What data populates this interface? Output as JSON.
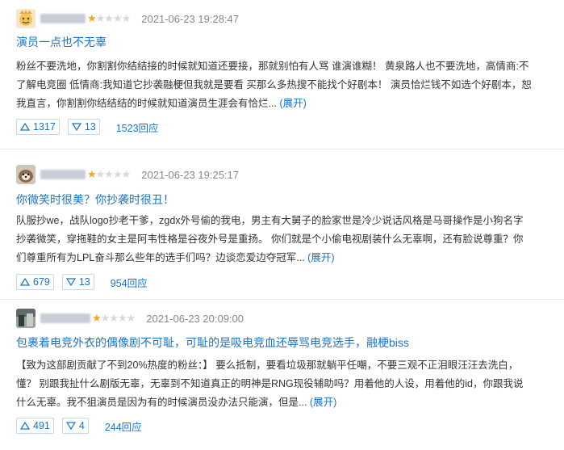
{
  "reviews": [
    {
      "rating": 1,
      "time": "2021-06-23 19:28:47",
      "title": "演员一点也不无辜",
      "content": "粉丝不要洗地，你割割你结结接的时候就知道还要接，那就别怕有人骂 谁演谁糊！ 黄泉路人也不要洗地，高情商:不了解电竞圈 低情商:我知道它抄袭融梗但我就是要看 买那么多热搜不能找个好剧本！ 演员恰烂钱不如选个好剧本，恕我直言，你割割你结结结的时候就知道演员生涯会有恰烂...",
      "expand": "(展开)",
      "up": "1317",
      "down": "13",
      "replies": "1523回应"
    },
    {
      "rating": 1,
      "time": "2021-06-23 19:25:17",
      "title": "你微笑时很美？你抄袭时很丑！",
      "content": "队服抄we，战队logo抄老干爹，zgdx外号偷的我电，男主有大舅子的脸家世是冷少说话风格是马哥操作是小狗名字抄袭微笑，穿拖鞋的女主是阿韦性格是谷夜外号是重扬。 你们就是个小偷电视剧装什么无辜啊，还有脸说尊重？你们尊重所有为LPL奋斗那么些年的选手们吗？边谈恋爱边夺冠军...",
      "expand": "(展开)",
      "up": "679",
      "down": "13",
      "replies": "954回应"
    },
    {
      "rating": 1,
      "time": "2021-06-23 20:09:00",
      "title": "包裹着电竞外衣的偶像剧不可耻，可耻的是吸电竞血还辱骂电竞选手，融梗biss",
      "content": "【致为这部剧贡献了不到20%热度的粉丝：】 要么抵制，要看垃圾那就躺平任嘲，不要三观不正泪眼汪汪去洗白，懂？ 别跟我扯什么剧版无辜，无辜到不知道真正的明神是RNG现役辅助吗？用着他的人设，用着他的id，你跟我说什么无辜。我不狙演员是因为有的时候演员没办法只能演，但是...",
      "expand": "(展开)",
      "up": "491",
      "down": "4",
      "replies": "244回应"
    }
  ],
  "colors": {
    "link": "#1a73c8",
    "star": "#f5a623",
    "muted": "#888888"
  },
  "icons": {
    "up": "triangle-up-icon",
    "down": "triangle-down-icon"
  }
}
